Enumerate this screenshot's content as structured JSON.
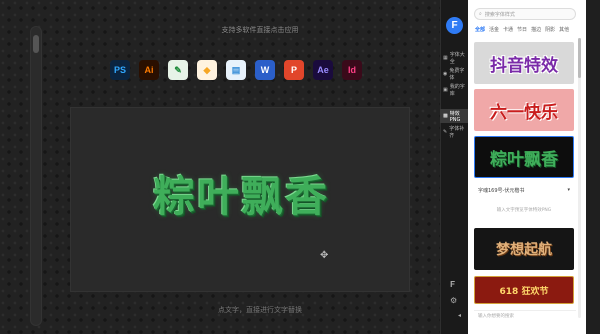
{
  "editor": {
    "hint_top": "支持多软件直接点击应用",
    "hint_bottom": "点文字，直接进行文字替换",
    "canvas_text": "粽叶飘香",
    "apps": [
      {
        "label": "PS",
        "name": "photoshop-icon",
        "bg": "#0b2440",
        "fg": "#31a8ff"
      },
      {
        "label": "Ai",
        "name": "illustrator-icon",
        "bg": "#2a0f00",
        "fg": "#ff7c00"
      },
      {
        "label": "✎",
        "name": "coreldraw-icon",
        "bg": "#e7f3e7",
        "fg": "#1e8b3a"
      },
      {
        "label": "◆",
        "name": "sketch-icon",
        "bg": "#fff3e0",
        "fg": "#f6a623"
      },
      {
        "label": "▤",
        "name": "keynote-icon",
        "bg": "#e8f2fb",
        "fg": "#3a8fd8"
      },
      {
        "label": "W",
        "name": "word-icon",
        "bg": "#2b5fc9",
        "fg": "#ffffff"
      },
      {
        "label": "P",
        "name": "powerpoint-icon",
        "bg": "#e1462b",
        "fg": "#ffffff"
      },
      {
        "label": "Ae",
        "name": "aftereffects-icon",
        "bg": "#1a0b3d",
        "fg": "#9a8cff"
      },
      {
        "label": "Id",
        "name": "indesign-icon",
        "bg": "#3a0a1a",
        "fg": "#ff3f86"
      }
    ]
  },
  "sidebar": {
    "logo": "F",
    "items": [
      {
        "label": "字体大全",
        "glyph": "▦",
        "active": false
      },
      {
        "label": "免费字体",
        "glyph": "◉",
        "active": false
      },
      {
        "label": "我的字库",
        "glyph": "▣",
        "active": false
      },
      {
        "label": "特效PNG",
        "glyph": "▩",
        "active": true
      },
      {
        "label": "字体补齐",
        "glyph": "✎",
        "active": false
      }
    ]
  },
  "panel": {
    "search_placeholder": "搜索字体样式",
    "tabs": [
      "全部",
      "活金",
      "卡通",
      "节日",
      "描边",
      "阴影",
      "其他"
    ],
    "active_tab": 0,
    "cards": [
      {
        "text": "抖音特效",
        "name": "effect-card-douyin"
      },
      {
        "text": "六一快乐",
        "name": "effect-card-liuyi"
      },
      {
        "text": "粽叶飘香",
        "name": "effect-card-zongye"
      },
      {
        "text": "梦想起航",
        "name": "effect-card-mengxiang"
      },
      {
        "text": "618 狂欢节",
        "name": "effect-card-618"
      }
    ],
    "font_select": "字魂169号-伏元楷书",
    "card_note": "输入文字预览字体特效PNG",
    "bottom_placeholder": "输入你想要的搜索"
  }
}
